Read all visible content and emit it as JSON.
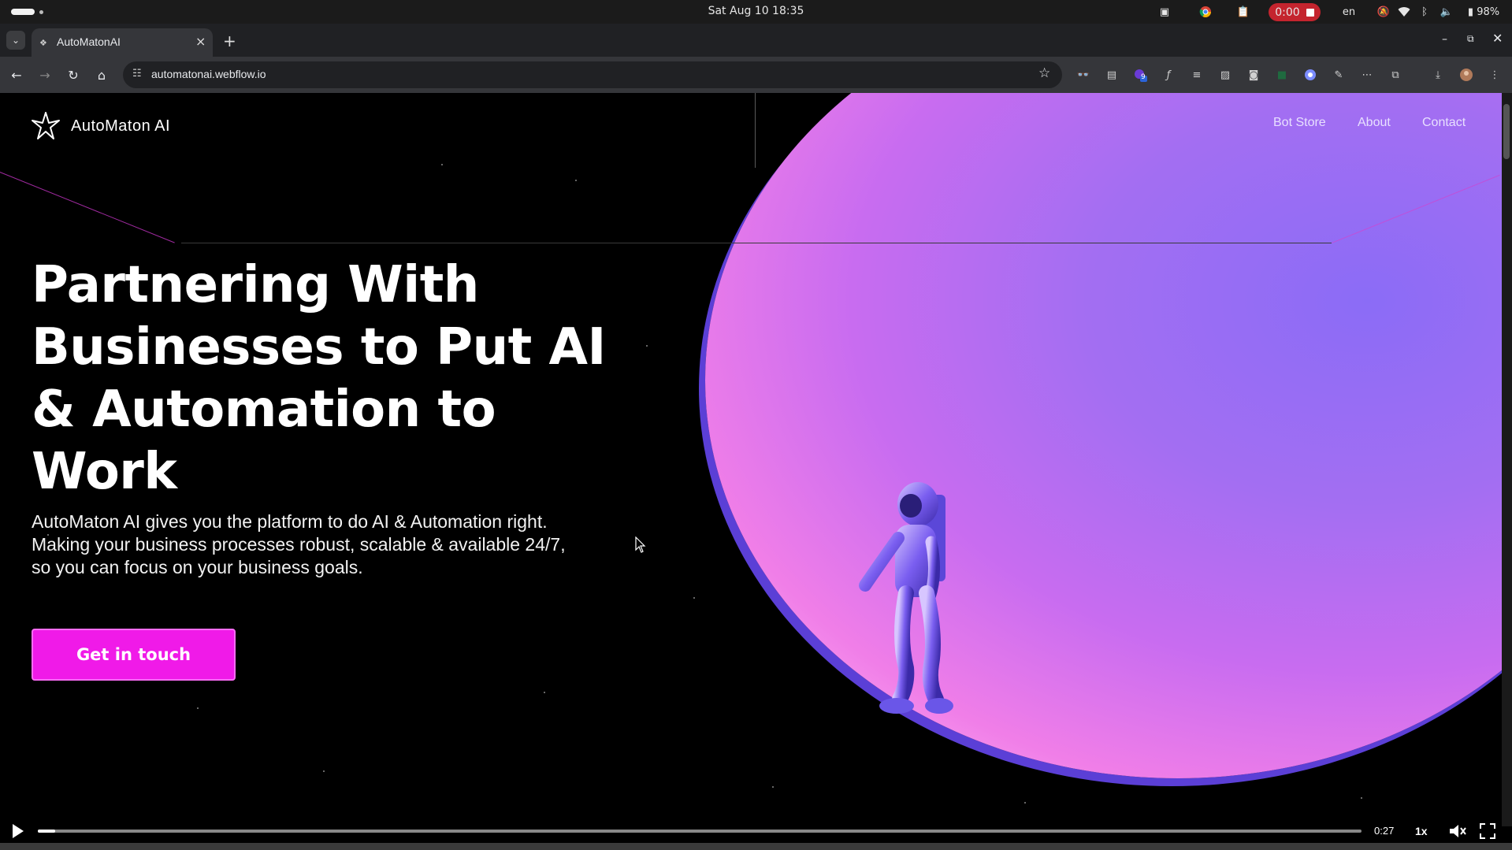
{
  "os": {
    "clock": "Sat Aug 10  18:35",
    "record_time": "0:00",
    "language": "en",
    "battery": "98%"
  },
  "browser": {
    "tab_title": "AutoMatonAI",
    "url": "automatonai.webflow.io",
    "extension_badge": "9"
  },
  "site": {
    "brand": "AutoMaton AI",
    "nav": [
      "Bot Store",
      "About",
      "Contact"
    ],
    "headline_lines": [
      "Partnering With",
      "Businesses to Put AI",
      "& Automation to",
      "Work"
    ],
    "subtext_lines": [
      "AutoMaton AI gives you the platform to do AI & Automation right.",
      "Making your business processes robust, scalable & available 24/7,",
      "so you can focus on your business goals."
    ],
    "cta": "Get in touch",
    "colors": {
      "accent": "#f01ae8",
      "planet": "#a36ef2",
      "background": "#000000"
    }
  },
  "video": {
    "time": "0:27",
    "speed": "1x",
    "progress": 0.013
  }
}
